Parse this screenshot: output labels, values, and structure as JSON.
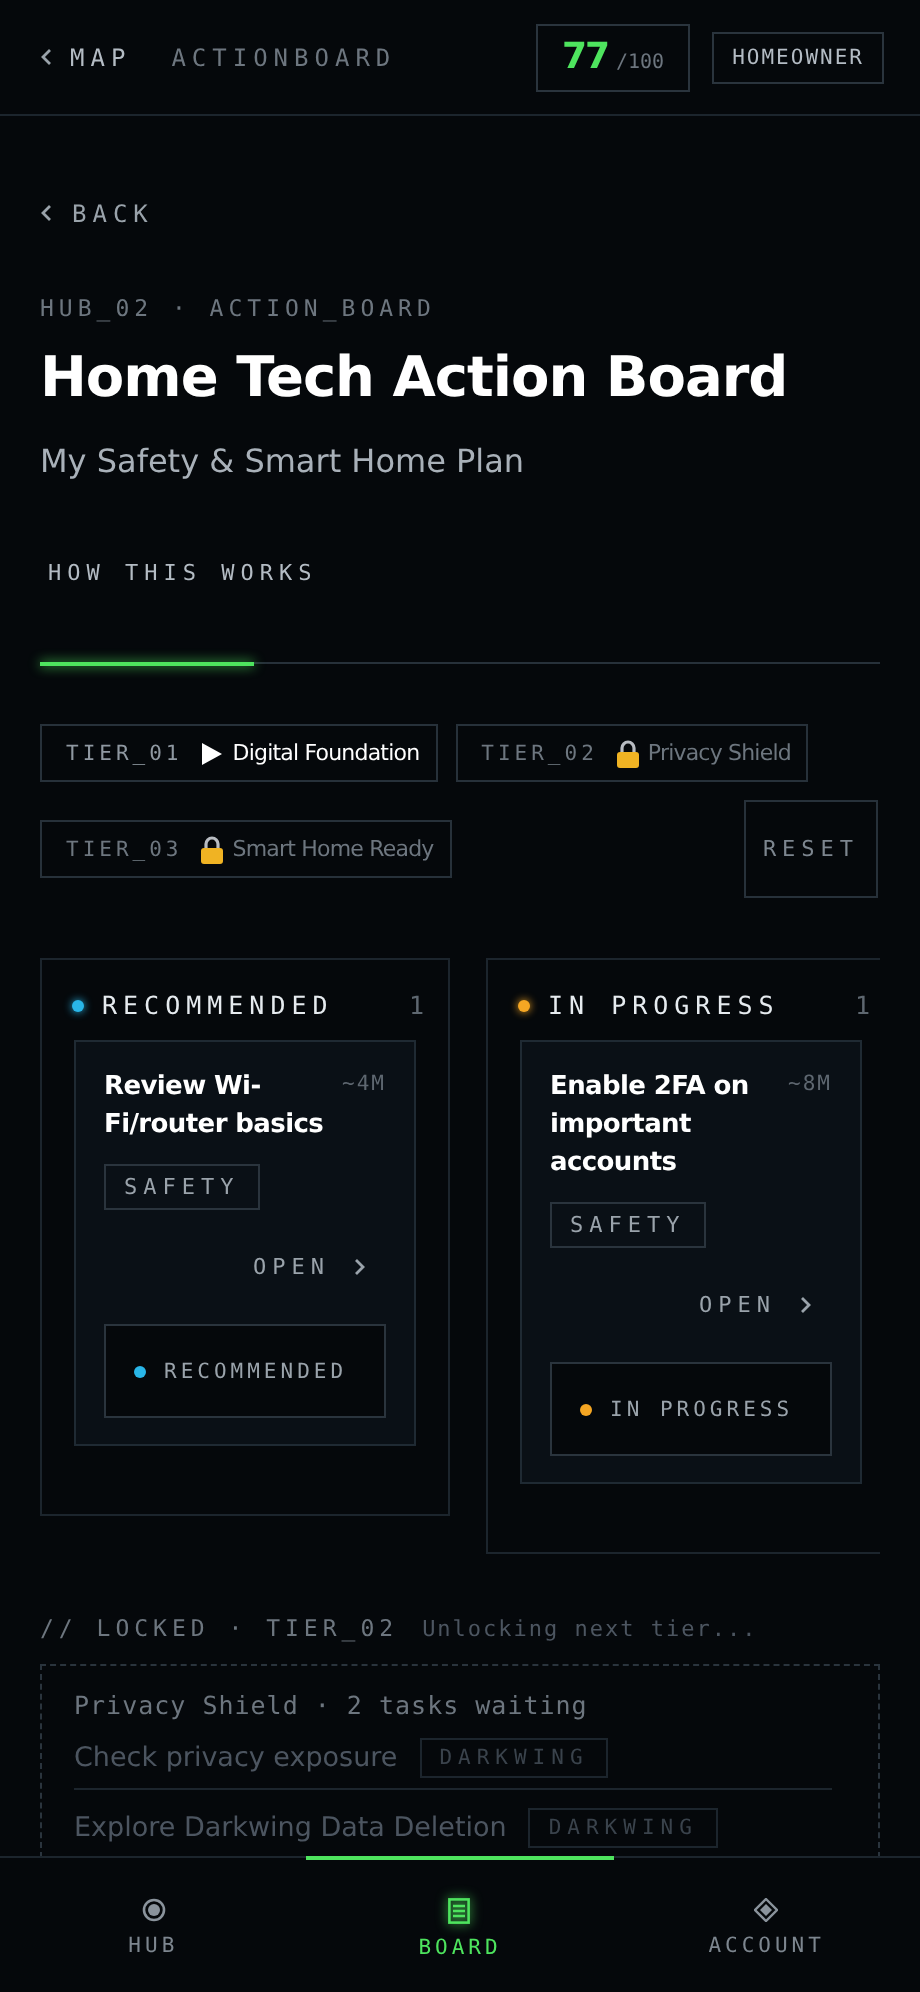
{
  "top_bar": {
    "back_label": "MAP",
    "breadcrumb": "ACTIONBOARD",
    "score": "77",
    "score_max": "/100",
    "role": "HOMEOWNER"
  },
  "header": {
    "back_label": "BACK",
    "eyebrow": "HUB_02 · ACTION_BOARD",
    "title": "Home Tech Action Board",
    "subtitle": "My Safety & Smart Home Plan",
    "how_link": "HOW THIS WORKS",
    "progress": {
      "level": 0.255
    }
  },
  "tiers": [
    {
      "code": "TIER_01",
      "label": "Digital Foundation",
      "selected": true,
      "locked": false
    },
    {
      "code": "TIER_02",
      "label": "Privacy Shield",
      "selected": false,
      "locked": true
    },
    {
      "code": "TIER_03",
      "label": "Smart Home Ready",
      "selected": false,
      "locked": true
    }
  ],
  "reset_button": "RESET",
  "columns": [
    {
      "title": "RECOMMENDED",
      "color": "#29b6e8",
      "count": "1",
      "cards": [
        {
          "title": "Review Wi-Fi/router basics",
          "time": "~4M",
          "tag": "SAFETY",
          "open": "OPEN",
          "status": "RECOMMENDED",
          "color": "#29b6e8"
        }
      ]
    },
    {
      "title": "IN PROGRESS",
      "color": "#f5a623",
      "count": "1",
      "cards": [
        {
          "title": "Enable 2FA on important accounts",
          "time": "~8M",
          "tag": "SAFETY",
          "open": "OPEN",
          "status": "IN PROGRESS",
          "color": "#f5a623"
        }
      ]
    }
  ],
  "locked": {
    "label": "// LOCKED · TIER_02",
    "note": "Unlocking next tier...",
    "summary": "Privacy Shield · 2 tasks waiting",
    "tasks": [
      {
        "title": "Check privacy exposure",
        "tag": "DARKWING"
      },
      {
        "title": "Explore Darkwing Data Deletion",
        "tag": "DARKWING"
      }
    ]
  },
  "nav": [
    {
      "label": "HUB",
      "kind": "hub",
      "selected": false
    },
    {
      "label": "BOARD",
      "kind": "board",
      "selected": true
    },
    {
      "label": "ACCOUNT",
      "kind": "account",
      "selected": false
    }
  ]
}
